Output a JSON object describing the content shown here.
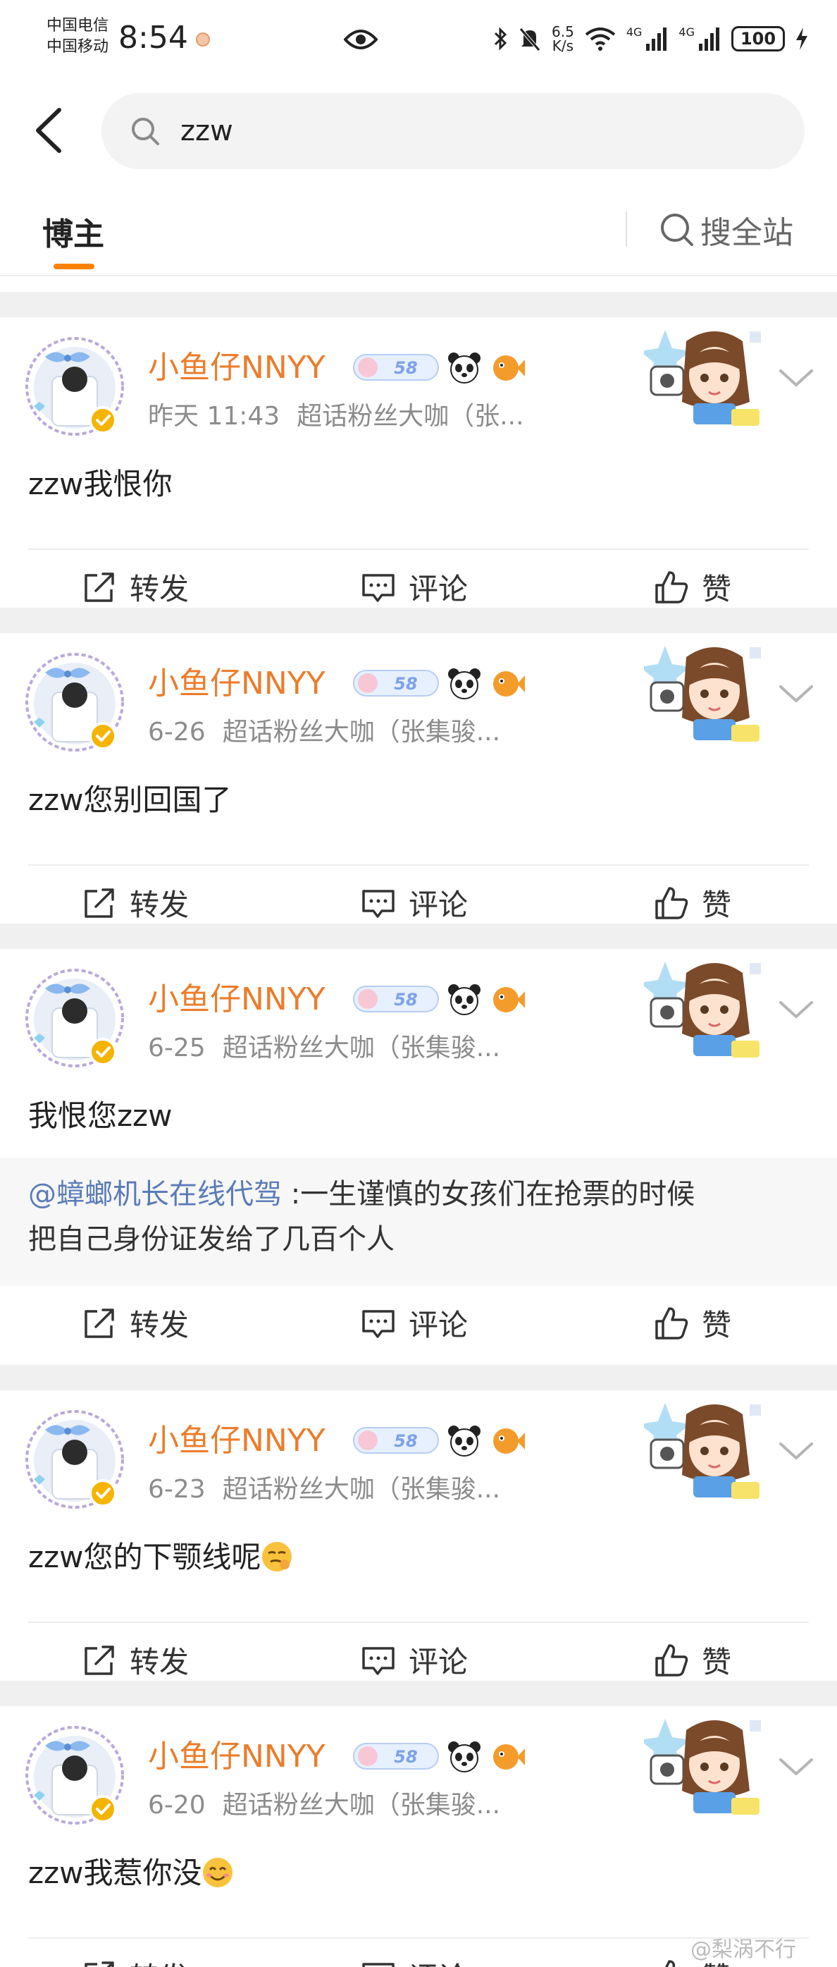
{
  "status_bar": {
    "carrier_1": "中国电信",
    "carrier_2": "中国移动",
    "time": "8:54",
    "net_speed_value": "6.5",
    "net_speed_unit": "K/s",
    "signal_1": "4G",
    "signal_2": "4G",
    "battery": "100"
  },
  "search": {
    "query": "zzw"
  },
  "tabs": {
    "bloggers": "博主",
    "search_all": "搜全站"
  },
  "user": {
    "name": "小鱼仔NNYY",
    "level_badge": "58"
  },
  "actions": {
    "repost": "转发",
    "comment": "评论",
    "like": "赞"
  },
  "posts": [
    {
      "time": "昨天 11:43",
      "source": "超话粉丝大咖（张...",
      "text": "zzw我恨你",
      "emoji": ""
    },
    {
      "time": "6-26",
      "source": "超话粉丝大咖（张集骏...",
      "text": "zzw您别回国了",
      "emoji": ""
    },
    {
      "time": "6-25",
      "source": "超话粉丝大咖（张集骏...",
      "text": "我恨您zzw",
      "emoji": "",
      "quote_mention": "@蟑螂机长在线代驾",
      "quote_line1": ":一生谨慎的女孩们在抢票的时候",
      "quote_line2": "把自己身份证发给了几百个人"
    },
    {
      "time": "6-23",
      "source": "超话粉丝大咖（张集骏...",
      "text": "zzw您的下颚线呢",
      "emoji": "sly-face-icon"
    },
    {
      "time": "6-20",
      "source": "超话粉丝大咖（张集骏...",
      "text": "zzw我惹你没",
      "emoji": "smile-face-icon"
    }
  ],
  "watermark": "@梨涡不行",
  "colors": {
    "accent": "#ff8200",
    "username": "#eb7d2b",
    "mention": "#5b7bb8",
    "meta": "#8c8c8c",
    "separator": "#f0f0f0"
  }
}
